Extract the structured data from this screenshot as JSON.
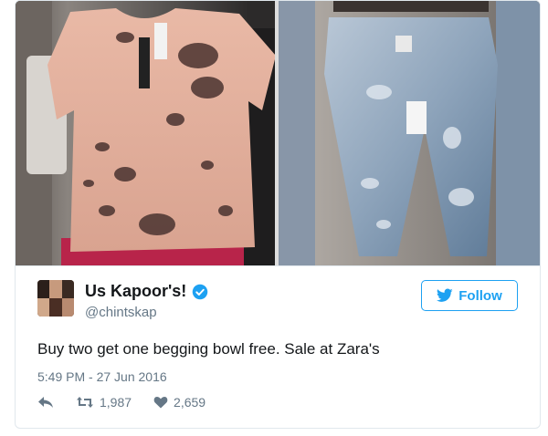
{
  "tweet": {
    "display_name": "Us Kapoor's!",
    "handle": "@chintskap",
    "text": "Buy two get one begging bowl free. Sale at Zara's",
    "timestamp": "5:49 PM - 27 Jun 2016",
    "follow_label": "Follow",
    "retweet_count": "1,987",
    "like_count": "2,659"
  },
  "media": [
    {
      "subject": "distressed pink t-shirt"
    },
    {
      "subject": "distressed jeans"
    }
  ],
  "icons": {
    "verified": "verified-badge-icon",
    "follow": "twitter-bird-icon",
    "reply": "reply-icon",
    "retweet": "retweet-icon",
    "like": "heart-icon"
  },
  "colors": {
    "accent": "#1da1f2",
    "muted": "#657786",
    "text": "#14171a",
    "border": "#e1e8ed"
  }
}
